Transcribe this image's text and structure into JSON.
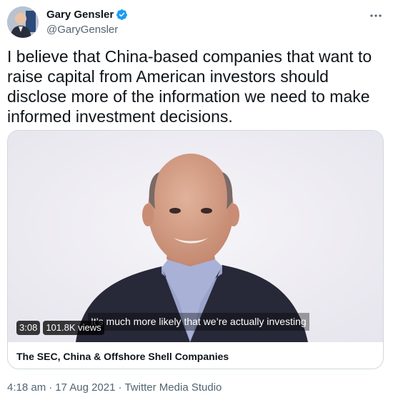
{
  "author": {
    "name": "Gary Gensler",
    "handle": "@GaryGensler",
    "avatar_icon": "avatar",
    "verified_color": "#1d9bf0"
  },
  "tweet": {
    "text": "I believe that China-based companies that want to raise capital from American investors should disclose more of the information we need to make informed investment decisions."
  },
  "video": {
    "duration": "3:08",
    "views": "101.8K views",
    "caption": "It’s much more likely that we’re actually investing",
    "title": "The SEC, China & Offshore Shell Companies"
  },
  "meta": {
    "time": "4:18 am",
    "date": "17 Aug 2021",
    "source": "Twitter Media Studio",
    "separator": "·"
  },
  "more_icon": "more-options-icon"
}
